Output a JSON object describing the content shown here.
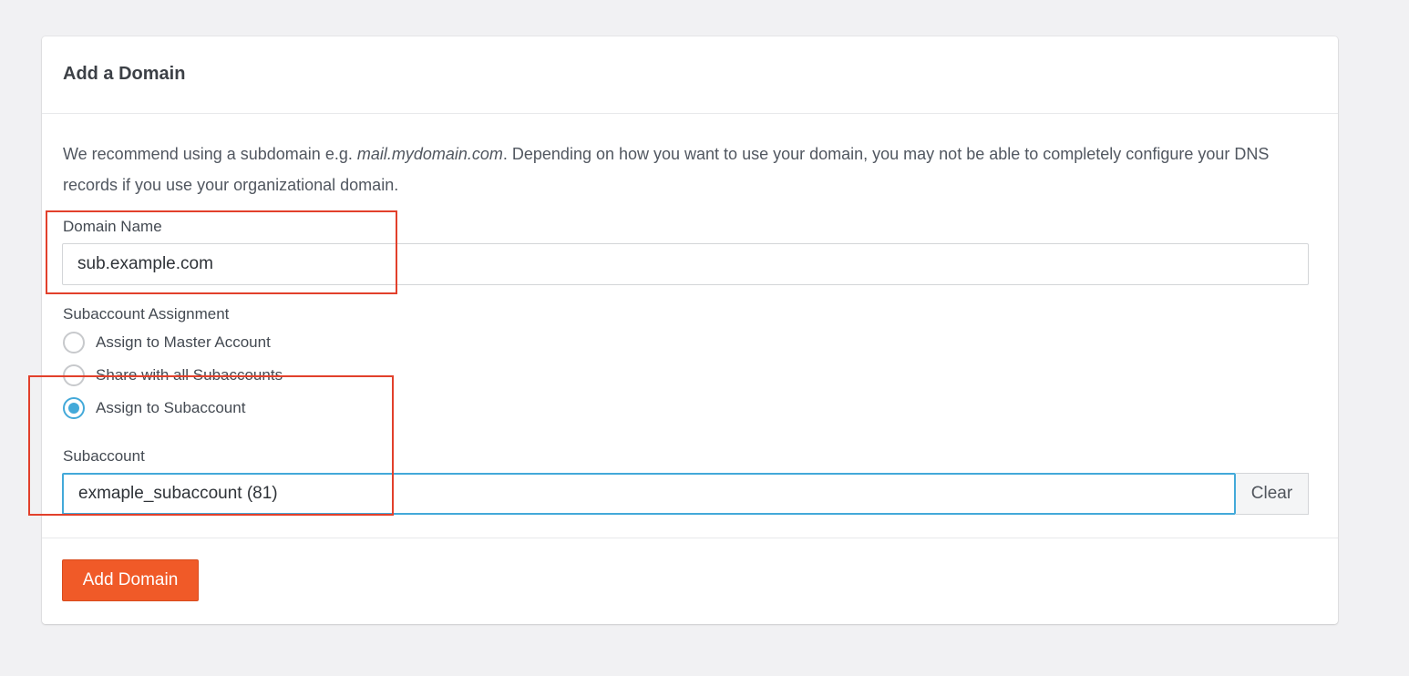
{
  "card": {
    "title": "Add a Domain",
    "intro_before": "We recommend using a subdomain e.g. ",
    "intro_example": "mail.mydomain.com",
    "intro_after": ". Depending on how you want to use your domain, you may not be able to completely configure your DNS records if you use your organizational domain."
  },
  "domain_field": {
    "label": "Domain Name",
    "value": "sub.example.com"
  },
  "assignment": {
    "label": "Subaccount Assignment",
    "options": [
      {
        "label": "Assign to Master Account",
        "checked": false
      },
      {
        "label": "Share with all Subaccounts",
        "checked": false
      },
      {
        "label": "Assign to Subaccount",
        "checked": true
      }
    ]
  },
  "subaccount_field": {
    "label": "Subaccount",
    "value": "exmaple_subaccount (81)",
    "clear_label": "Clear"
  },
  "footer": {
    "submit_label": "Add Domain"
  },
  "colors": {
    "accent": "#43a9d9",
    "primary_button": "#f05a28",
    "annotation": "#e2402b"
  }
}
